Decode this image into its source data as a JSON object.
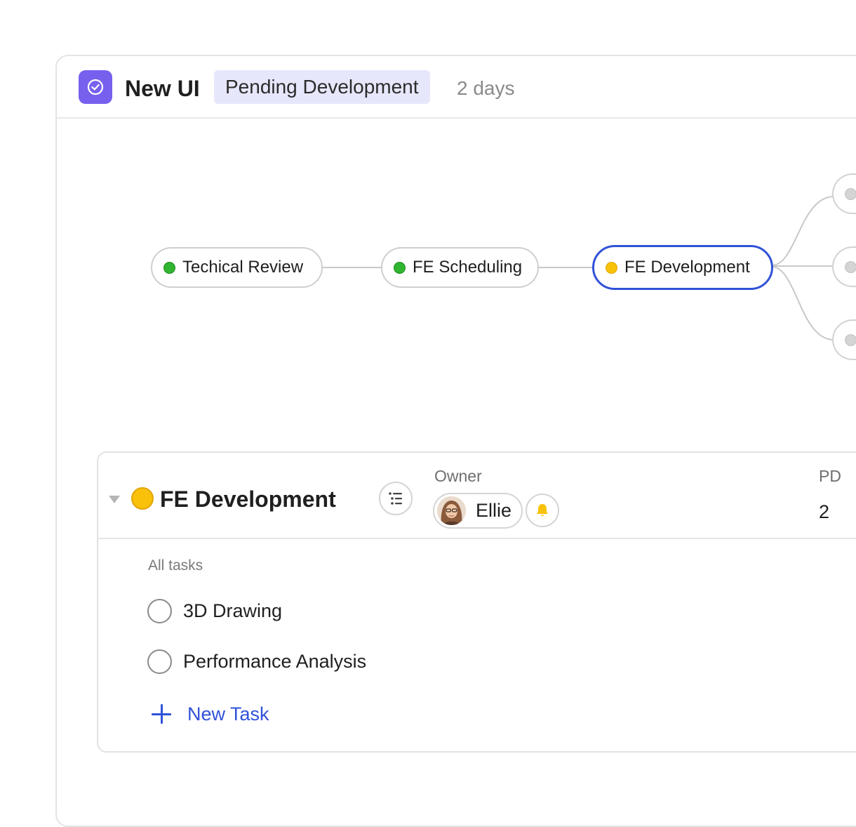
{
  "header": {
    "title": "New UI",
    "status": "Pending Development",
    "duration": "2 days",
    "accent": "#7760ee",
    "status_bg": "#e6e7fb"
  },
  "flow": {
    "nodes": [
      {
        "label": "Techical Review",
        "status": "done",
        "color": "#2fb52f"
      },
      {
        "label": "FE Scheduling",
        "status": "done",
        "color": "#2fb52f"
      },
      {
        "label": "FE Development",
        "status": "in-progress",
        "color": "#f8c20a",
        "active": true
      }
    ],
    "next_nodes_count": 3,
    "active_color": "#3152d8"
  },
  "stage": {
    "title": "FE Development",
    "owner_label": "Owner",
    "owner_name": "Ellie",
    "pd_label": "PD",
    "pd_value": "2",
    "tasks_label": "All tasks",
    "tasks": [
      {
        "label": "3D Drawing",
        "done": false
      },
      {
        "label": "Performance Analysis",
        "done": false
      }
    ],
    "new_task_label": "New Task"
  }
}
